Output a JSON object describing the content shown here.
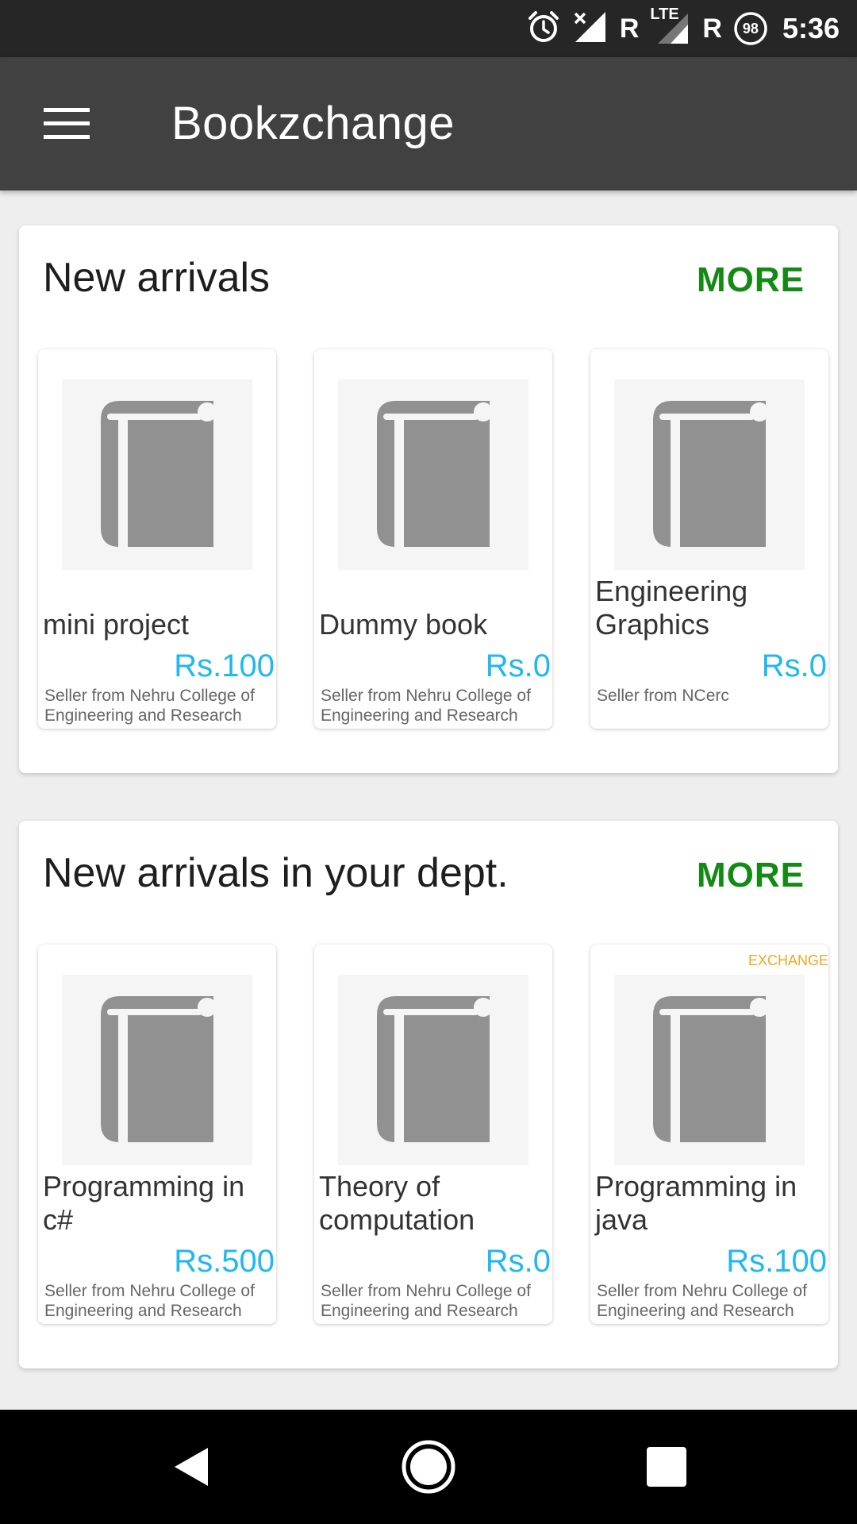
{
  "status_bar": {
    "roaming_1": "R",
    "network_type": "LTE",
    "roaming_2": "R",
    "battery": "98",
    "time": "5:36"
  },
  "app_bar": {
    "title": "Bookzchange",
    "menu_icon": "hamburger-menu-icon"
  },
  "sections": [
    {
      "title": "New arrivals",
      "more_label": "MORE",
      "books": [
        {
          "name": "mini project",
          "price": "Rs.100",
          "seller": "Seller from Nehru College of Engineering and Research",
          "badge": ""
        },
        {
          "name": "Dummy book",
          "price": "Rs.0",
          "seller": "Seller from Nehru College of Engineering and Research",
          "badge": ""
        },
        {
          "name": "Engineering Graphics",
          "price": "Rs.0",
          "seller": "Seller from NCerc",
          "badge": ""
        }
      ]
    },
    {
      "title": "New arrivals in your dept.",
      "more_label": "MORE",
      "books": [
        {
          "name": "Programming in c#",
          "price": "Rs.500",
          "seller": "Seller from Nehru College of Engineering and Research",
          "badge": ""
        },
        {
          "name": "Theory of computation",
          "price": "Rs.0",
          "seller": "Seller from Nehru College of Engineering and Research",
          "badge": ""
        },
        {
          "name": "Programming in java",
          "price": "Rs.100",
          "seller": "Seller from Nehru College of Engineering and Research",
          "badge": "EXCHANGE"
        }
      ]
    }
  ],
  "nav_bar": {
    "back_icon": "back-icon",
    "home_icon": "home-icon",
    "recents_icon": "recents-icon"
  },
  "colors": {
    "app_bar": "#414141",
    "more": "#138a13",
    "price": "#1fb8ef",
    "badge": "#f5a623"
  }
}
